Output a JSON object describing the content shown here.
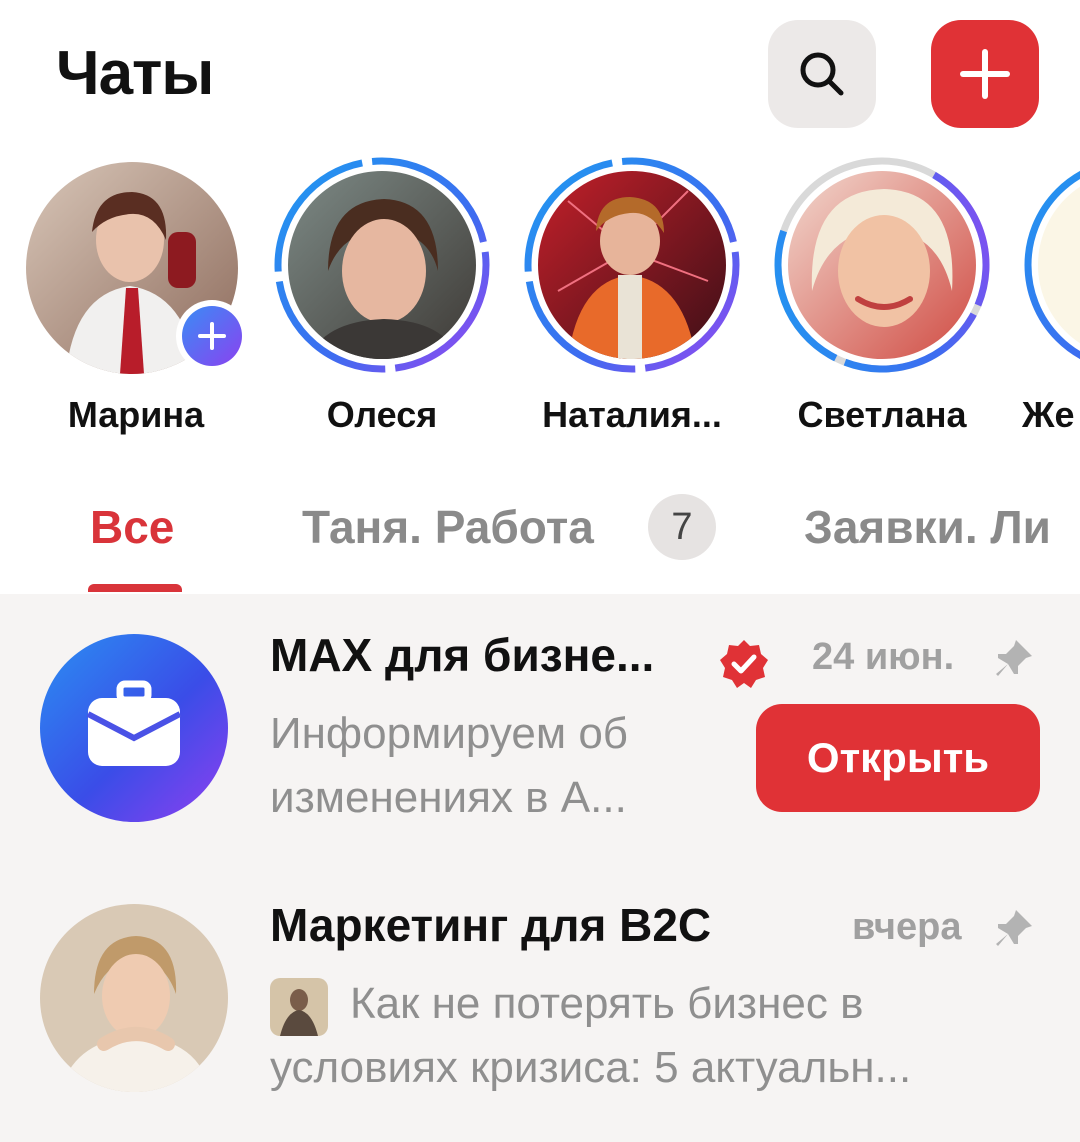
{
  "header": {
    "title": "Чаты",
    "search_icon": "search-icon",
    "add_icon": "plus-icon",
    "accent": "#e03236"
  },
  "stories": [
    {
      "name": "Марина",
      "own": true
    },
    {
      "name": "Олеся"
    },
    {
      "name": "Наталия..."
    },
    {
      "name": "Светлана"
    },
    {
      "name": "Же"
    }
  ],
  "tabs": [
    {
      "label": "Все",
      "active": true
    },
    {
      "label": "Таня. Работа",
      "count": "7"
    },
    {
      "label": "Заявки. Ли"
    }
  ],
  "chats": [
    {
      "name": "MAX для бизне...",
      "verified": true,
      "time": "24 июн.",
      "pinned": true,
      "preview_line1": "Информируем об",
      "preview_line2": "изменениях в А...",
      "action_label": "Открыть",
      "avatar_icon": "briefcase-icon"
    },
    {
      "name": "Маркетинг для B2C",
      "time": "вчера",
      "pinned": true,
      "preview_line1": "Как не потерять бизнес в",
      "preview_line2": "условиях кризиса: 5 актуальн..."
    }
  ]
}
